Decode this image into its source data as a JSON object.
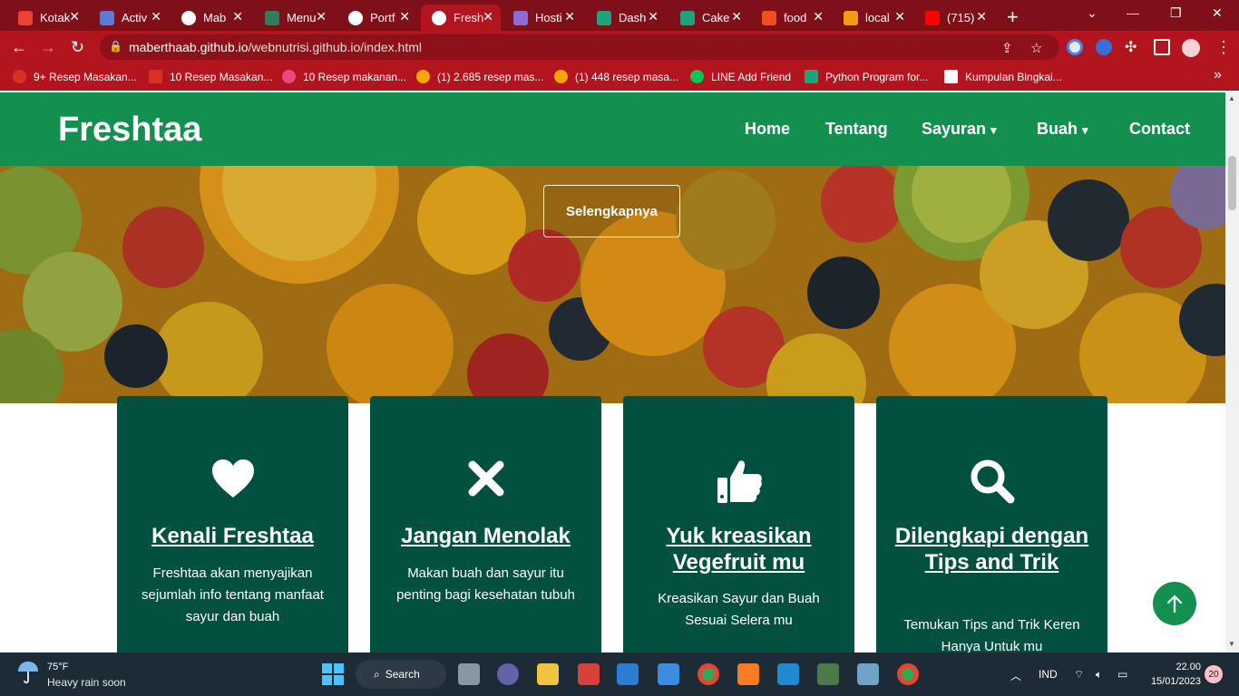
{
  "browser": {
    "tabs": [
      {
        "label": "Kotak",
        "color": "#ea4335"
      },
      {
        "label": "Activ",
        "color": "#5b7bd5"
      },
      {
        "label": "Mab",
        "color": "#ffffff"
      },
      {
        "label": "Menu",
        "color": "#2e7d5b"
      },
      {
        "label": "Portf",
        "color": "#ffffff"
      },
      {
        "label": "Fresh",
        "color": "#ffffff"
      },
      {
        "label": "Hosti",
        "color": "#8e6bd6"
      },
      {
        "label": "Dash",
        "color": "#1fa37a"
      },
      {
        "label": "Cake",
        "color": "#1fa37a"
      },
      {
        "label": "food",
        "color": "#f24e1e"
      },
      {
        "label": "local",
        "color": "#f39c12"
      },
      {
        "label": "(715)",
        "color": "#ff0000"
      }
    ],
    "new_tab_symbol": "+",
    "url_host": "maberthaab.github.io",
    "url_path": "/webnutrisi.github.io/index.html",
    "bookmarks": [
      {
        "label": "9+ Resep Masakan...",
        "color": "#d93025"
      },
      {
        "label": "10 Resep Masakan...",
        "color": "#d93025"
      },
      {
        "label": "10 Resep makanan...",
        "color": "#e84a7f"
      },
      {
        "label": "(1) 2.685 resep mas...",
        "color": "#f7a600"
      },
      {
        "label": "(1) 448 resep masa...",
        "color": "#f7a600"
      },
      {
        "label": "LINE Add Friend",
        "color": "#06c755"
      },
      {
        "label": "Python Program for...",
        "color": "#1fa37a"
      },
      {
        "label": "Kumpulan Bingkai...",
        "color": "#ffffff"
      }
    ],
    "more_bookmarks": "»"
  },
  "site": {
    "brand": "Freshtaa",
    "nav": [
      "Home",
      "Tentang",
      "Sayuran",
      "Buah",
      "Contact"
    ],
    "hero_button": "Selengkapnya",
    "cards": [
      {
        "icon": "heart-icon",
        "title": "Kenali Freshtaa",
        "text": "Freshtaa akan menyajikan sejumlah info tentang manfaat sayur dan buah"
      },
      {
        "icon": "close-icon",
        "title": "Jangan Menolak",
        "text": "Makan buah dan sayur itu penting bagi kesehatan tubuh"
      },
      {
        "icon": "thumbs-up-icon",
        "title": "Yuk kreasikan Vegefruit mu",
        "text": "Kreasikan Sayur dan Buah Sesuai Selera mu"
      },
      {
        "icon": "search-icon",
        "title": "Dilengkapi dengan Tips and Trik",
        "text": "Temukan Tips and Trik Keren Hanya Untuk mu"
      }
    ],
    "colors": {
      "nav_green": "#13904f",
      "card_green": "#02503f"
    }
  },
  "taskbar": {
    "temperature": "75°F",
    "weather_status": "Heavy rain soon",
    "search_label": "Search",
    "language": "IND",
    "time": "22.00",
    "date": "15/01/2023",
    "notifications": "20"
  }
}
